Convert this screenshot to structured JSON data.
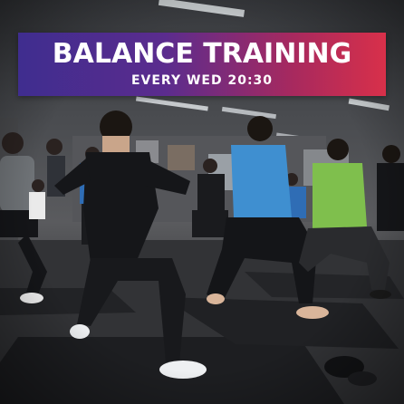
{
  "banner": {
    "title": "BALANCE TRAINING",
    "subtitle": "EVERY WED 20:30",
    "gradient_start": "#3f2d8f",
    "gradient_end": "#d8304a",
    "text_color": "#ffffff"
  },
  "photo": {
    "colors": {
      "ceiling": "#3a3c40",
      "floor": "#2b2c2e",
      "mat": "#1e1f22",
      "blue_shirt": "#3f8fd0",
      "green_shirt": "#7fbf4d",
      "black_outfit": "#151619",
      "skin": "#d9b59a"
    }
  }
}
